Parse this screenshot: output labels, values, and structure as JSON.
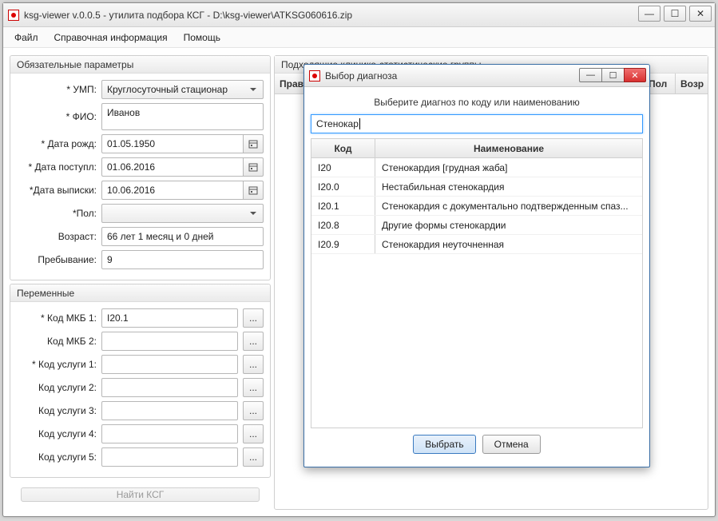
{
  "window": {
    "title": "ksg-viewer v.0.0.5 - утилита подбора КСГ  -  D:\\ksg-viewer\\ATKSG060616.zip",
    "min": "—",
    "max": "☐",
    "close": "✕"
  },
  "menu": {
    "file": "Файл",
    "help_info": "Справочная информация",
    "help": "Помощь"
  },
  "left": {
    "required_caption": "Обязательные параметры",
    "vars_caption": "Переменные",
    "labels": {
      "ump": "* УМП:",
      "fio": "* ФИО:",
      "birth": "* Дата рожд:",
      "arrive": "* Дата поступл:",
      "discharge": "*Дата выписки:",
      "sex": "*Пол:",
      "age": "Возраст:",
      "stay": "Пребывание:",
      "mkb1": "* Код МКБ 1:",
      "mkb2": "Код МКБ 2:",
      "srv1": "* Код услуги 1:",
      "srv2": "Код услуги 2:",
      "srv3": "Код услуги 3:",
      "srv4": "Код услуги 4:",
      "srv5": "Код услуги 5:"
    },
    "ump_value": "Круглосуточный стационар",
    "fio_value": "Иванов",
    "birth": "01.05.1950",
    "arrive": "01.06.2016",
    "discharge": "10.06.2016",
    "sex": "",
    "age": "66 лет 1 месяц и 0 дней",
    "stay": "9",
    "mkb1": "I20.1",
    "mkb2": "",
    "srv1": "",
    "srv2": "",
    "srv3": "",
    "srv4": "",
    "srv5": "",
    "find_btn": "Найти КСГ",
    "dots": "..."
  },
  "right": {
    "caption": "Подходящие клинико-статистические группы",
    "cols": {
      "pravilo": "Правило",
      "mid": "",
      "pol": "Пол",
      "vozr": "Возр"
    }
  },
  "modal": {
    "title": "Выбор диагноза",
    "instruction": "Выберите диагноз по коду или наименованию",
    "search": "Стенокар",
    "col_code": "Код",
    "col_name": "Наименование",
    "rows": [
      {
        "code": "I20",
        "name": "Стенокардия [грудная жаба]"
      },
      {
        "code": "I20.0",
        "name": "Нестабильная стенокардия"
      },
      {
        "code": "I20.1",
        "name": "Стенокардия с документально подтвержденным спаз..."
      },
      {
        "code": "I20.8",
        "name": "Другие формы стенокардии"
      },
      {
        "code": "I20.9",
        "name": "Стенокардия неуточненная"
      }
    ],
    "select": "Выбрать",
    "cancel": "Отмена",
    "min": "—",
    "max": "☐",
    "close": "✕"
  }
}
